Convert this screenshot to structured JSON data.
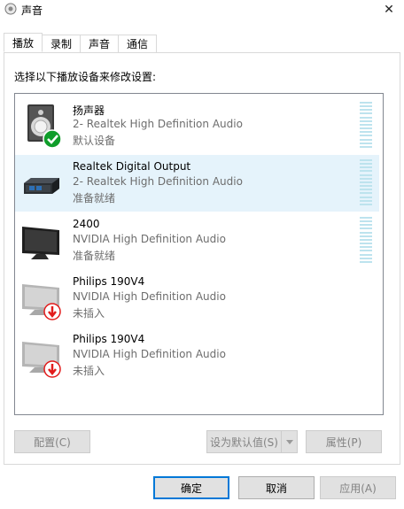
{
  "window": {
    "title": "声音",
    "close_symbol": "✕"
  },
  "tabs": [
    {
      "label": "播放",
      "active": true
    },
    {
      "label": "录制",
      "active": false
    },
    {
      "label": "声音",
      "active": false
    },
    {
      "label": "通信",
      "active": false
    }
  ],
  "instruction": "选择以下播放设备来修改设置:",
  "devices": [
    {
      "name": "扬声器",
      "description": "2- Realtek High Definition Audio",
      "status": "默认设备",
      "icon": "speaker-icon",
      "badge": "default-check-icon",
      "selected": false
    },
    {
      "name": "Realtek Digital Output",
      "description": "2- Realtek High Definition Audio",
      "status": "准备就绪",
      "icon": "digital-output-icon",
      "badge": "",
      "selected": true
    },
    {
      "name": "2400",
      "description": "NVIDIA High Definition Audio",
      "status": "准备就绪",
      "icon": "monitor-icon",
      "badge": "",
      "selected": false
    },
    {
      "name": "Philips 190V4",
      "description": "NVIDIA High Definition Audio",
      "status": "未插入",
      "icon": "monitor-disconnected-icon",
      "badge": "unplugged-icon",
      "selected": false
    },
    {
      "name": "Philips 190V4",
      "description": "NVIDIA High Definition Audio",
      "status": "未插入",
      "icon": "monitor-disconnected-icon",
      "badge": "unplugged-icon",
      "selected": false
    }
  ],
  "buttons": {
    "configure": "配置(C)",
    "set_default": "设为默认值(S)",
    "properties": "属性(P)",
    "ok": "确定",
    "cancel": "取消",
    "apply": "应用(A)"
  },
  "colors": {
    "selected_row": "#e5f3fb",
    "meter": "#bde3ee",
    "default_button_border": "#0078d7",
    "check_badge": "#0f9d2a",
    "unplugged_badge": "#e21b1b"
  }
}
